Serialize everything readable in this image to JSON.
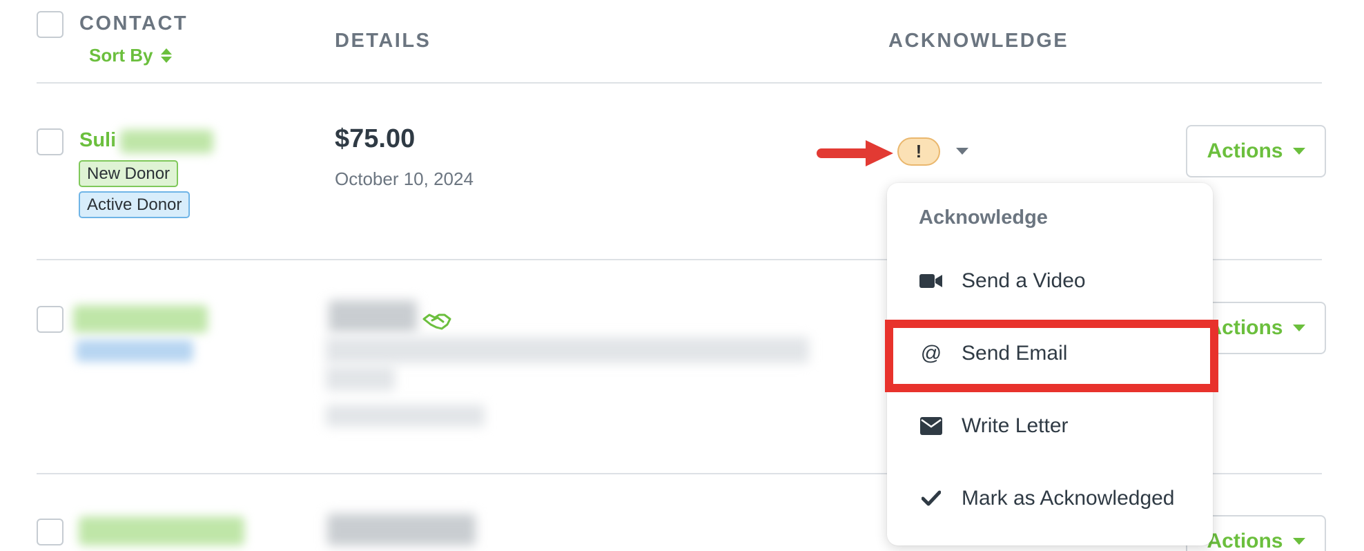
{
  "header": {
    "contact_label": "CONTACT",
    "sort_by_label": "Sort By",
    "details_label": "DETAILS",
    "acknowledge_label": "ACKNOWLEDGE"
  },
  "row1": {
    "first_name": "Suli",
    "tags": [
      "New Donor",
      "Active Donor"
    ],
    "amount": "$75.00",
    "date": "October 10, 2024",
    "ack_badge": "!",
    "actions_label": "Actions"
  },
  "row2": {
    "actions_label": "Actions"
  },
  "row3": {
    "actions_label": "Actions"
  },
  "dropdown": {
    "title": "Acknowledge",
    "items": [
      {
        "label": "Send a Video",
        "icon": "video-camera-icon"
      },
      {
        "label": "Send Email",
        "icon": "at-sign-icon"
      },
      {
        "label": "Write Letter",
        "icon": "envelope-icon"
      },
      {
        "label": "Mark as Acknowledged",
        "icon": "checkmark-icon"
      }
    ]
  },
  "colors": {
    "brand_green": "#6bbf3d",
    "annotation_red": "#e8322c",
    "warning_badge": "#fbe1b5"
  }
}
